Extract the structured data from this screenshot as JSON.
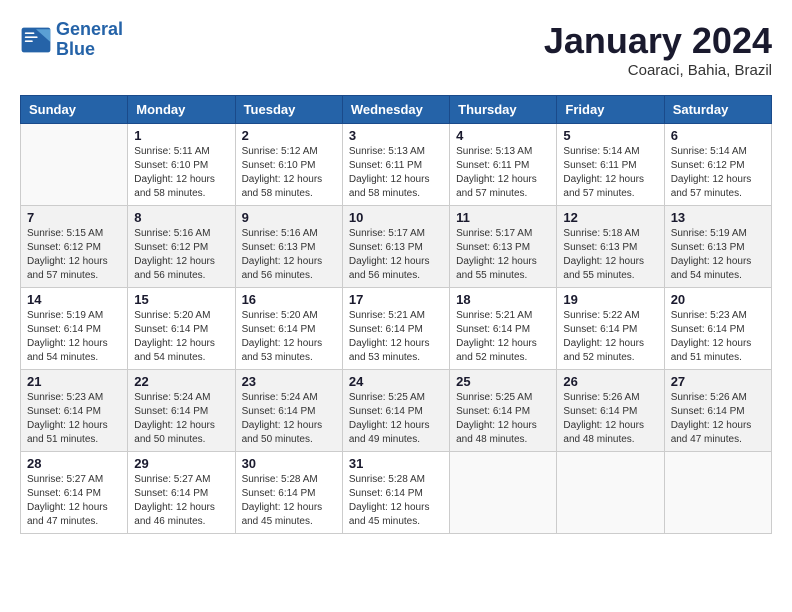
{
  "header": {
    "logo_line1": "General",
    "logo_line2": "Blue",
    "month_year": "January 2024",
    "location": "Coaraci, Bahia, Brazil"
  },
  "days_of_week": [
    "Sunday",
    "Monday",
    "Tuesday",
    "Wednesday",
    "Thursday",
    "Friday",
    "Saturday"
  ],
  "weeks": [
    [
      {
        "day": "",
        "empty": true
      },
      {
        "day": "1",
        "sunrise": "5:11 AM",
        "sunset": "6:10 PM",
        "daylight": "12 hours and 58 minutes."
      },
      {
        "day": "2",
        "sunrise": "5:12 AM",
        "sunset": "6:10 PM",
        "daylight": "12 hours and 58 minutes."
      },
      {
        "day": "3",
        "sunrise": "5:13 AM",
        "sunset": "6:11 PM",
        "daylight": "12 hours and 58 minutes."
      },
      {
        "day": "4",
        "sunrise": "5:13 AM",
        "sunset": "6:11 PM",
        "daylight": "12 hours and 57 minutes."
      },
      {
        "day": "5",
        "sunrise": "5:14 AM",
        "sunset": "6:11 PM",
        "daylight": "12 hours and 57 minutes."
      },
      {
        "day": "6",
        "sunrise": "5:14 AM",
        "sunset": "6:12 PM",
        "daylight": "12 hours and 57 minutes."
      }
    ],
    [
      {
        "day": "7",
        "sunrise": "5:15 AM",
        "sunset": "6:12 PM",
        "daylight": "12 hours and 57 minutes."
      },
      {
        "day": "8",
        "sunrise": "5:16 AM",
        "sunset": "6:12 PM",
        "daylight": "12 hours and 56 minutes."
      },
      {
        "day": "9",
        "sunrise": "5:16 AM",
        "sunset": "6:13 PM",
        "daylight": "12 hours and 56 minutes."
      },
      {
        "day": "10",
        "sunrise": "5:17 AM",
        "sunset": "6:13 PM",
        "daylight": "12 hours and 56 minutes."
      },
      {
        "day": "11",
        "sunrise": "5:17 AM",
        "sunset": "6:13 PM",
        "daylight": "12 hours and 55 minutes."
      },
      {
        "day": "12",
        "sunrise": "5:18 AM",
        "sunset": "6:13 PM",
        "daylight": "12 hours and 55 minutes."
      },
      {
        "day": "13",
        "sunrise": "5:19 AM",
        "sunset": "6:13 PM",
        "daylight": "12 hours and 54 minutes."
      }
    ],
    [
      {
        "day": "14",
        "sunrise": "5:19 AM",
        "sunset": "6:14 PM",
        "daylight": "12 hours and 54 minutes."
      },
      {
        "day": "15",
        "sunrise": "5:20 AM",
        "sunset": "6:14 PM",
        "daylight": "12 hours and 54 minutes."
      },
      {
        "day": "16",
        "sunrise": "5:20 AM",
        "sunset": "6:14 PM",
        "daylight": "12 hours and 53 minutes."
      },
      {
        "day": "17",
        "sunrise": "5:21 AM",
        "sunset": "6:14 PM",
        "daylight": "12 hours and 53 minutes."
      },
      {
        "day": "18",
        "sunrise": "5:21 AM",
        "sunset": "6:14 PM",
        "daylight": "12 hours and 52 minutes."
      },
      {
        "day": "19",
        "sunrise": "5:22 AM",
        "sunset": "6:14 PM",
        "daylight": "12 hours and 52 minutes."
      },
      {
        "day": "20",
        "sunrise": "5:23 AM",
        "sunset": "6:14 PM",
        "daylight": "12 hours and 51 minutes."
      }
    ],
    [
      {
        "day": "21",
        "sunrise": "5:23 AM",
        "sunset": "6:14 PM",
        "daylight": "12 hours and 51 minutes."
      },
      {
        "day": "22",
        "sunrise": "5:24 AM",
        "sunset": "6:14 PM",
        "daylight": "12 hours and 50 minutes."
      },
      {
        "day": "23",
        "sunrise": "5:24 AM",
        "sunset": "6:14 PM",
        "daylight": "12 hours and 50 minutes."
      },
      {
        "day": "24",
        "sunrise": "5:25 AM",
        "sunset": "6:14 PM",
        "daylight": "12 hours and 49 minutes."
      },
      {
        "day": "25",
        "sunrise": "5:25 AM",
        "sunset": "6:14 PM",
        "daylight": "12 hours and 48 minutes."
      },
      {
        "day": "26",
        "sunrise": "5:26 AM",
        "sunset": "6:14 PM",
        "daylight": "12 hours and 48 minutes."
      },
      {
        "day": "27",
        "sunrise": "5:26 AM",
        "sunset": "6:14 PM",
        "daylight": "12 hours and 47 minutes."
      }
    ],
    [
      {
        "day": "28",
        "sunrise": "5:27 AM",
        "sunset": "6:14 PM",
        "daylight": "12 hours and 47 minutes."
      },
      {
        "day": "29",
        "sunrise": "5:27 AM",
        "sunset": "6:14 PM",
        "daylight": "12 hours and 46 minutes."
      },
      {
        "day": "30",
        "sunrise": "5:28 AM",
        "sunset": "6:14 PM",
        "daylight": "12 hours and 45 minutes."
      },
      {
        "day": "31",
        "sunrise": "5:28 AM",
        "sunset": "6:14 PM",
        "daylight": "12 hours and 45 minutes."
      },
      {
        "day": "",
        "empty": true
      },
      {
        "day": "",
        "empty": true
      },
      {
        "day": "",
        "empty": true
      }
    ]
  ]
}
